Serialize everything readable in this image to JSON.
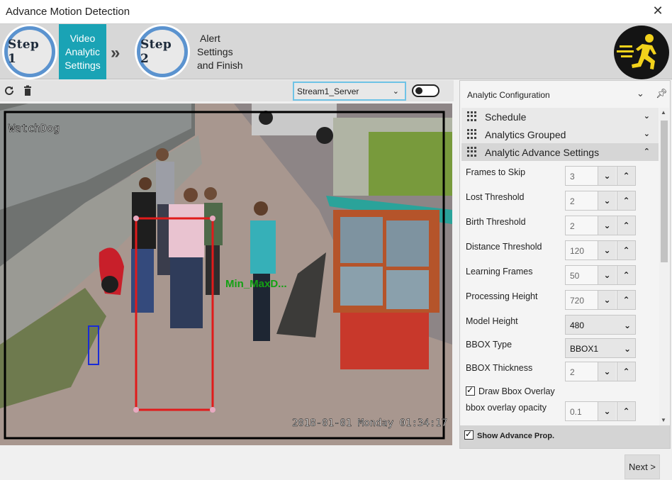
{
  "window": {
    "title": "Advance Motion Detection",
    "close_glyph": "✕"
  },
  "wizard": {
    "step1": {
      "badge": "Step 1",
      "label_lines": [
        "Video",
        "Analytic",
        "Settings"
      ]
    },
    "separator": "»",
    "step2": {
      "badge": "Step 2",
      "label_lines": [
        "Alert",
        "Settings",
        "and Finish"
      ]
    },
    "icon": "running-man-icon",
    "active_color": "#1aa3b5"
  },
  "toolbar": {
    "refresh_icon": "refresh-icon",
    "delete_icon": "trash-icon",
    "stream_value": "Stream1_Server",
    "toggle_state": "off"
  },
  "video": {
    "overlay_name": "WatchDog",
    "timestamp": "2018-01-01 Monday 01:34:17",
    "detection_label": "Min_MaxD...",
    "box_colors": {
      "roi": "#000000",
      "max": "#e01b1b",
      "min": "#1a2bd6",
      "label": "#13a113"
    }
  },
  "panel": {
    "title": "Analytic Configuration",
    "sections": [
      {
        "label": "Schedule",
        "expanded": false
      },
      {
        "label": "Analytics Grouped",
        "expanded": false
      },
      {
        "label": "Analytic Advance Settings",
        "expanded": true
      }
    ],
    "fields": {
      "frames_to_skip": {
        "label": "Frames to Skip",
        "value": "3"
      },
      "lost_threshold": {
        "label": "Lost Threshold",
        "value": "2"
      },
      "birth_threshold": {
        "label": "Birth Threshold",
        "value": "2"
      },
      "distance_threshold": {
        "label": "Distance Threshold",
        "value": "120"
      },
      "learning_frames": {
        "label": "Learning Frames",
        "value": "50"
      },
      "processing_height": {
        "label": "Processing Height",
        "value": "720"
      },
      "model_height": {
        "label": "Model Height",
        "value": "480"
      },
      "bbox_type": {
        "label": "BBOX Type",
        "value": "BBOX1"
      },
      "bbox_thickness": {
        "label": "BBOX Thickness",
        "value": "2"
      },
      "draw_bbox_overlay": {
        "label": "Draw Bbox Overlay",
        "checked": true
      },
      "bbox_overlay_opacity": {
        "label": "bbox overlay opacity",
        "value": "0.1"
      }
    },
    "show_advance": {
      "label": "Show Advance Prop.",
      "checked": true
    }
  },
  "footer": {
    "next_label": "Next >"
  }
}
